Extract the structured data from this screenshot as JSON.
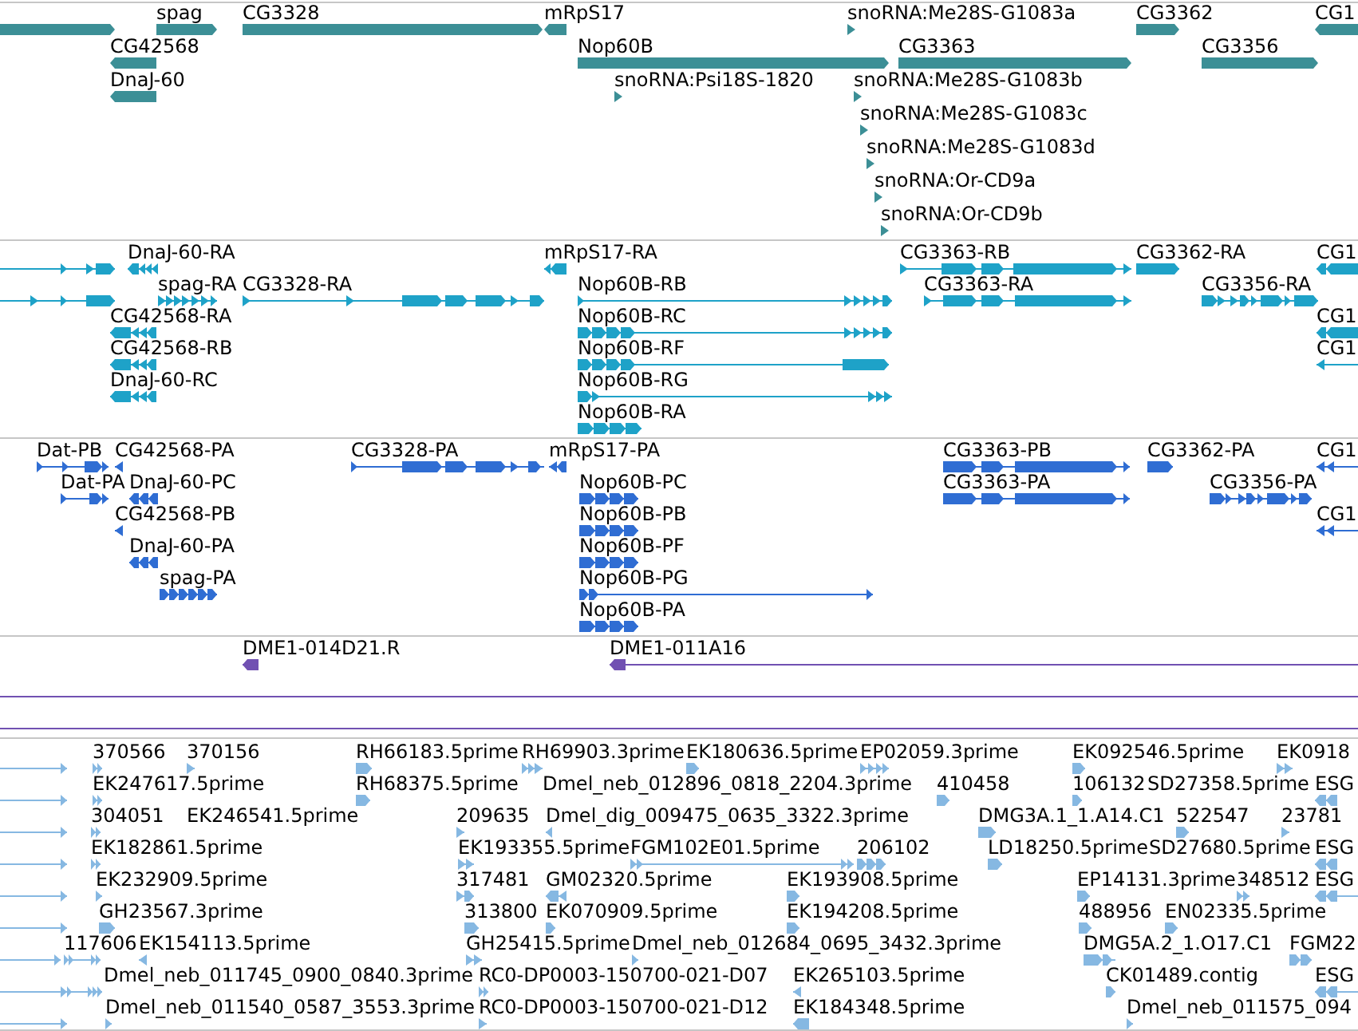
{
  "tracks": [
    {
      "kind": "gene",
      "rows": [
        {
          "features": [
            {
              "reverse": false
            },
            {
              "label": "spag",
              "reverse": false
            },
            {
              "label": "CG3328",
              "reverse": false
            },
            {
              "label": "mRpS17",
              "reverse": true
            },
            {
              "label": "snoRNA:Me28S-G1083a",
              "reverse": false
            },
            {
              "label": "CG3362",
              "reverse": false
            },
            {
              "label": "CG1",
              "reverse": true
            }
          ]
        },
        {
          "features": [
            {
              "label": "CG42568",
              "reverse": true
            },
            {
              "label": "Nop60B",
              "reverse": false
            },
            {
              "label": "CG3363",
              "reverse": false
            },
            {
              "label": "CG3356",
              "reverse": false
            }
          ]
        },
        {
          "features": [
            {
              "label": "DnaJ-60",
              "reverse": true
            },
            {
              "label": "snoRNA:Psi18S-1820",
              "reverse": false
            },
            {
              "label": "snoRNA:Me28S-G1083b",
              "reverse": false
            }
          ]
        },
        {
          "features": [
            {
              "label": "snoRNA:Me28S-G1083c",
              "reverse": false
            }
          ]
        },
        {
          "features": [
            {
              "label": "snoRNA:Me28S-G1083d",
              "reverse": false
            }
          ]
        },
        {
          "features": [
            {
              "label": "snoRNA:Or-CD9a",
              "reverse": false
            }
          ]
        },
        {
          "features": [
            {
              "label": "snoRNA:Or-CD9b",
              "reverse": false
            }
          ]
        }
      ]
    },
    {
      "kind": "transcript",
      "rows": [
        {
          "features": [
            {
              "reverse": false
            },
            {
              "label": "DnaJ-60-RA",
              "reverse": true
            },
            {
              "label": "mRpS17-RA",
              "reverse": true
            },
            {
              "label": "CG3363-RB",
              "reverse": false
            },
            {
              "label": "CG3362-RA",
              "reverse": false
            },
            {
              "label": "CG1",
              "reverse": true
            }
          ]
        },
        {
          "features": [
            {
              "reverse": false
            },
            {
              "label": "spag-RA",
              "reverse": false
            },
            {
              "label": "CG3328-RA",
              "reverse": false
            },
            {
              "label": "Nop60B-RB",
              "reverse": false
            },
            {
              "label": "CG3363-RA",
              "reverse": false
            },
            {
              "label": "CG3356-RA",
              "reverse": false
            }
          ]
        },
        {
          "features": [
            {
              "label": "CG42568-RA",
              "reverse": true
            },
            {
              "label": "Nop60B-RC",
              "reverse": false
            },
            {
              "label": "CG1",
              "reverse": true
            }
          ]
        },
        {
          "features": [
            {
              "label": "CG42568-RB",
              "reverse": true
            },
            {
              "label": "Nop60B-RF",
              "reverse": false
            },
            {
              "label": "CG1",
              "reverse": true
            }
          ]
        },
        {
          "features": [
            {
              "label": "DnaJ-60-RC",
              "reverse": true
            },
            {
              "label": "Nop60B-RG",
              "reverse": false
            }
          ]
        },
        {
          "features": [
            {
              "label": "Nop60B-RA",
              "reverse": false
            }
          ]
        }
      ]
    },
    {
      "kind": "protein",
      "rows": [
        {
          "features": [
            {
              "label": "Dat-PB",
              "reverse": false
            },
            {
              "label": "CG42568-PA",
              "reverse": true
            },
            {
              "label": "CG3328-PA",
              "reverse": false
            },
            {
              "label": "mRpS17-PA",
              "reverse": true
            },
            {
              "label": "CG3363-PB",
              "reverse": false
            },
            {
              "label": "CG3362-PA",
              "reverse": false
            },
            {
              "label": "CG1",
              "reverse": true
            }
          ]
        },
        {
          "features": [
            {
              "label": "Dat-PA",
              "reverse": false
            },
            {
              "label": "DnaJ-60-PC",
              "reverse": true
            },
            {
              "label": "Nop60B-PC",
              "reverse": false
            },
            {
              "label": "CG3363-PA",
              "reverse": false
            },
            {
              "label": "CG3356-PA",
              "reverse": false
            }
          ]
        },
        {
          "features": [
            {
              "label": "CG42568-PB",
              "reverse": true
            },
            {
              "label": "Nop60B-PB",
              "reverse": false
            },
            {
              "label": "CG1",
              "reverse": true
            }
          ]
        },
        {
          "features": [
            {
              "label": "DnaJ-60-PA",
              "reverse": true
            },
            {
              "label": "Nop60B-PF",
              "reverse": false
            }
          ]
        },
        {
          "features": [
            {
              "label": "spag-PA",
              "reverse": false
            },
            {
              "label": "Nop60B-PG",
              "reverse": false
            }
          ]
        },
        {
          "features": [
            {
              "label": "Nop60B-PA",
              "reverse": false
            }
          ]
        }
      ]
    },
    {
      "kind": "clone",
      "rows": [
        {
          "features": [
            {
              "label": "DME1-014D21.R",
              "reverse": true
            },
            {
              "label": "DME1-011A16",
              "reverse": true
            }
          ]
        },
        {
          "features": [
            {
              "kind": "span"
            }
          ]
        },
        {
          "features": [
            {
              "kind": "span"
            }
          ]
        }
      ]
    },
    {
      "kind": "est",
      "rows": [
        {
          "features": [
            {
              "reverse": false
            },
            {
              "label": "370566",
              "reverse": false
            },
            {
              "label": "370156",
              "reverse": false
            },
            {
              "label": "RH66183.5prime",
              "reverse": false
            },
            {
              "label": "RH69903.3prime",
              "reverse": false
            },
            {
              "label": "EK180636.5prime",
              "reverse": false
            },
            {
              "label": "EP02059.3prime",
              "reverse": false
            },
            {
              "label": "EK092546.5prime",
              "reverse": false
            },
            {
              "label": "EK0918",
              "reverse": false
            }
          ]
        },
        {
          "features": [
            {
              "reverse": false
            },
            {
              "label": "EK247617.5prime",
              "reverse": false
            },
            {
              "label": "RH68375.5prime",
              "reverse": false
            },
            {
              "label": "Dmel_neb_012896_0818_2204.3prime"
            },
            {
              "label": "410458",
              "reverse": false
            },
            {
              "label": "106132",
              "reverse": false
            },
            {
              "label": "SD27358.5prime"
            },
            {
              "label": "ESG",
              "reverse": true
            }
          ]
        },
        {
          "features": [
            {
              "reverse": false
            },
            {
              "label": "304051",
              "reverse": false
            },
            {
              "label": "EK246541.5prime"
            },
            {
              "label": "209635",
              "reverse": false
            },
            {
              "label": "Dmel_dig_009475_0635_3322.3prime",
              "reverse": true
            },
            {
              "label": "DMG3A.1_1.A14.C1",
              "reverse": false
            },
            {
              "label": "522547",
              "reverse": false
            },
            {
              "label": "23781",
              "reverse": false
            }
          ]
        },
        {
          "features": [
            {
              "reverse": false
            },
            {
              "label": "EK182861.5prime",
              "reverse": false
            },
            {
              "label": "EK193355.5prime",
              "reverse": false
            },
            {
              "label": "FGM102E01.5prime",
              "reverse": false
            },
            {
              "label": "206102",
              "reverse": false
            },
            {
              "label": "LD18250.5prime",
              "reverse": false
            },
            {
              "label": "SD27680.5prime"
            },
            {
              "label": "ESG",
              "reverse": true
            }
          ]
        },
        {
          "features": [
            {
              "reverse": false
            },
            {
              "label": "EK232909.5prime",
              "reverse": false
            },
            {
              "label": "317481",
              "reverse": false
            },
            {
              "label": "GM02320.5prime",
              "reverse": true
            },
            {
              "label": "EK193908.5prime",
              "reverse": false
            },
            {
              "label": "EP14131.3prime",
              "reverse": false
            },
            {
              "label": "348512",
              "reverse": false
            },
            {
              "label": "ESG",
              "reverse": true
            }
          ]
        },
        {
          "features": [
            {
              "reverse": false
            },
            {
              "label": "GH23567.3prime",
              "reverse": false
            },
            {
              "label": "313800",
              "reverse": false
            },
            {
              "label": "EK070909.5prime",
              "reverse": false
            },
            {
              "label": "EK194208.5prime",
              "reverse": false
            },
            {
              "label": "488956",
              "reverse": false
            },
            {
              "label": "EN02335.5prime",
              "reverse": false
            }
          ]
        },
        {
          "features": [
            {
              "reverse": false
            },
            {
              "label": "117606",
              "reverse": false
            },
            {
              "label": "EK154113.5prime",
              "reverse": true
            },
            {
              "label": "GH25415.5prime",
              "reverse": false
            },
            {
              "label": "Dmel_neb_012684_0695_3432.3prime",
              "reverse": false
            },
            {
              "label": "DMG5A.2_1.O17.C1",
              "reverse": false
            },
            {
              "label": "FGM22",
              "reverse": false
            }
          ]
        },
        {
          "features": [
            {
              "reverse": false
            },
            {
              "label": "Dmel_neb_011745_0900_0840.3prime"
            },
            {
              "label": "RC0-DP0003-150700-021-D07",
              "reverse": false
            },
            {
              "label": "EK265103.5prime",
              "reverse": true
            },
            {
              "label": "CK01489.contig",
              "reverse": false
            },
            {
              "label": "ESG",
              "reverse": true
            }
          ]
        },
        {
          "features": [
            {
              "reverse": false
            },
            {
              "label": "Dmel_neb_011540_0587_3553.3prime",
              "reverse": false
            },
            {
              "label": "RC0-DP0003-150700-021-D12",
              "reverse": false
            },
            {
              "label": "EK184348.5prime",
              "reverse": true
            },
            {
              "label": "Dmel_neb_011575_094",
              "reverse": false
            }
          ]
        }
      ]
    }
  ]
}
